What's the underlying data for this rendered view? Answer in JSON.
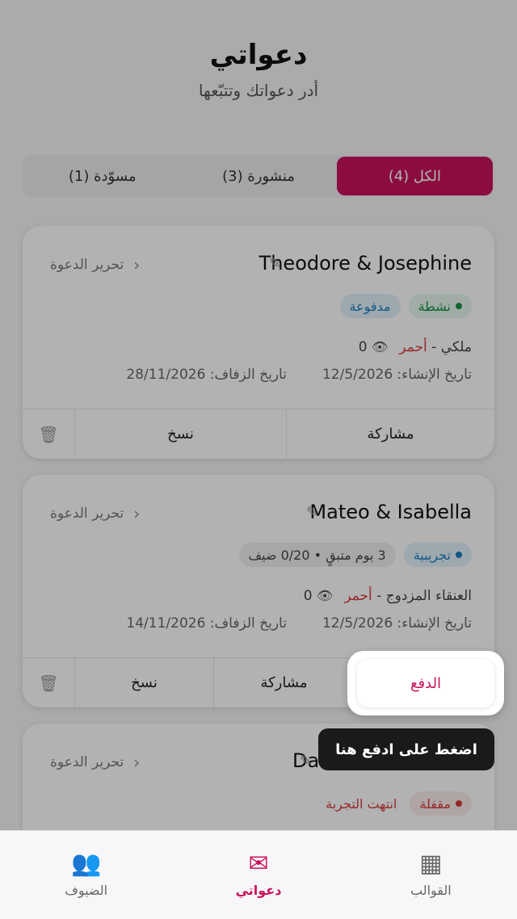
{
  "header": {
    "title": "دعواتي",
    "subtitle": "أدر دعواتك وتتبّعها"
  },
  "tabs": [
    {
      "label": "الكل (4)",
      "active": true
    },
    {
      "label": "منشورة (3)",
      "active": false
    },
    {
      "label": "مسوّدة (1)",
      "active": false
    }
  ],
  "cards": [
    {
      "name": "Theodore & Josephine",
      "edit_label": "تحرير الدعوة",
      "status": "نشطة",
      "payment": "مدفوعة",
      "template": "ملكي -",
      "color": "أحمر",
      "views": "0",
      "created": "تاريخ الإنشاء: 12/5/2026",
      "wedding": "تاريخ الزفاف: 28/11/2026",
      "share": "مشاركة",
      "copy": "نسخ"
    },
    {
      "name": "Mateo & Isabella",
      "edit_label": "تحرير الدعوة",
      "status": "تجريبية",
      "trial_info": "3 يوم متبقٍ • 0/20 ضيف",
      "template": "العنقاء المزدوج -",
      "color": "أحمر",
      "views": "0",
      "created": "تاريخ الإنشاء: 12/5/2026",
      "wedding": "تاريخ الزفاف: 14/11/2026",
      "pay": "الدفع",
      "share": "مشاركة",
      "copy": "نسخ"
    },
    {
      "name": "Daniel & Charlotte",
      "edit_label": "تحرير الدعوة",
      "status": "مقفلة",
      "trial_state": "انتهت التجربة"
    }
  ],
  "tooltip": "اضغط على ادفع هنا",
  "nav": [
    {
      "label": "القوالب",
      "icon": "templates-icon"
    },
    {
      "label": "دعواتي",
      "icon": "envelope-icon",
      "active": true
    },
    {
      "label": "الضيوف",
      "icon": "guests-icon"
    }
  ],
  "colors": {
    "accent": "#c8135c"
  }
}
